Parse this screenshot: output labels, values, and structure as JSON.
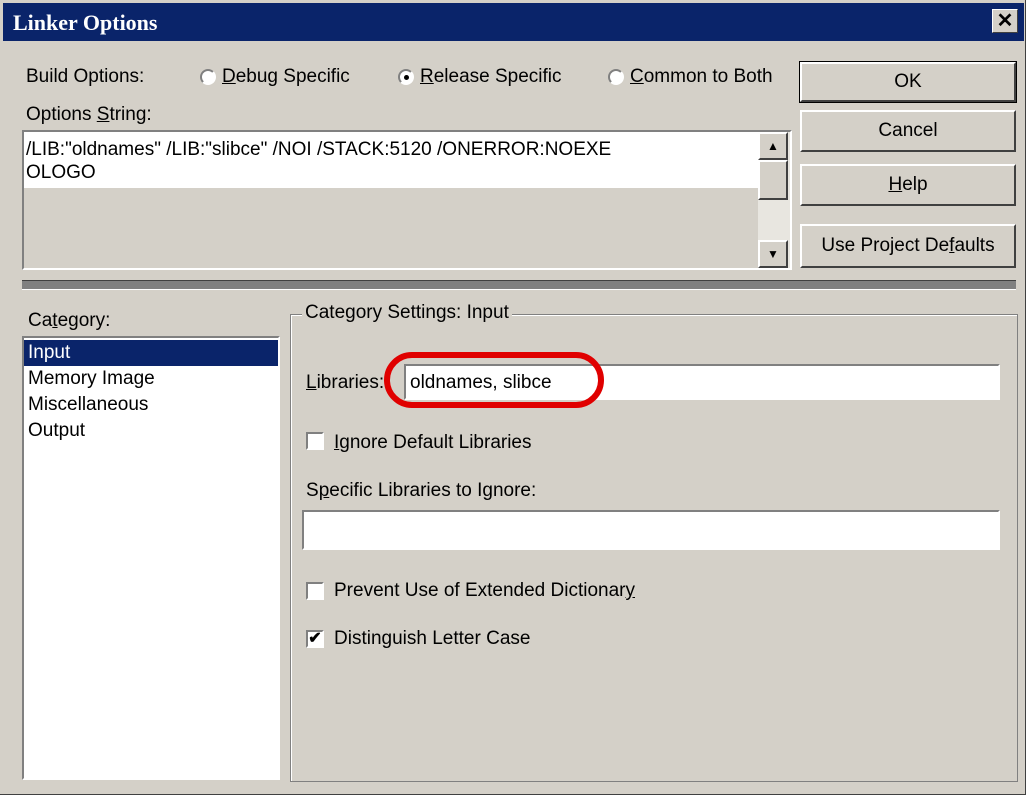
{
  "window": {
    "title": "Linker Options",
    "close_glyph": "✕"
  },
  "build_options": {
    "label": "Build Options:",
    "radios": [
      {
        "label_pre": "",
        "label_u": "D",
        "label_post": "ebug Specific",
        "selected": false
      },
      {
        "label_pre": "",
        "label_u": "R",
        "label_post": "elease Specific",
        "selected": true
      },
      {
        "label_pre": "",
        "label_u": "C",
        "label_post": "ommon to Both",
        "selected": false
      }
    ]
  },
  "options_string": {
    "label_pre": "Options ",
    "label_u": "S",
    "label_post": "tring:",
    "line1": "/LIB:\"oldnames\" /LIB:\"slibce\" /NOI /STACK:5120 /ONERROR:NOEXE",
    "line2": "OLOGO"
  },
  "buttons": {
    "ok": "OK",
    "cancel": "Cancel",
    "help_u": "H",
    "help_post": "elp",
    "defaults_pre": "Use Project De",
    "defaults_u": "f",
    "defaults_post": "aults"
  },
  "category": {
    "label_pre": "Ca",
    "label_u": "t",
    "label_post": "egory:",
    "items": [
      "Input",
      "Memory Image",
      "Miscellaneous",
      "Output"
    ],
    "selected_index": 0
  },
  "settings": {
    "group_label": "Category Settings: Input",
    "libraries_label_pre": "",
    "libraries_label_u": "L",
    "libraries_label_post": "ibraries:",
    "libraries_value": "oldnames, slibce",
    "ignore_default_pre": "",
    "ignore_default_u": "I",
    "ignore_default_post": "gnore Default Libraries",
    "ignore_default_checked": false,
    "specific_pre": "S",
    "specific_u": "p",
    "specific_post": "ecific Libraries to Ignore:",
    "specific_value": "",
    "prevent_pre": "Prevent Use of Extended Dictionar",
    "prevent_u": "y",
    "prevent_post": "",
    "prevent_checked": false,
    "distinguish_pre": "Distin",
    "distinguish_u": "g",
    "distinguish_post": "uish Letter Case",
    "distinguish_checked": true
  },
  "colors": {
    "highlight_ring": "#e00000",
    "title_bg": "#0a246a",
    "face": "#d4d0c8"
  }
}
